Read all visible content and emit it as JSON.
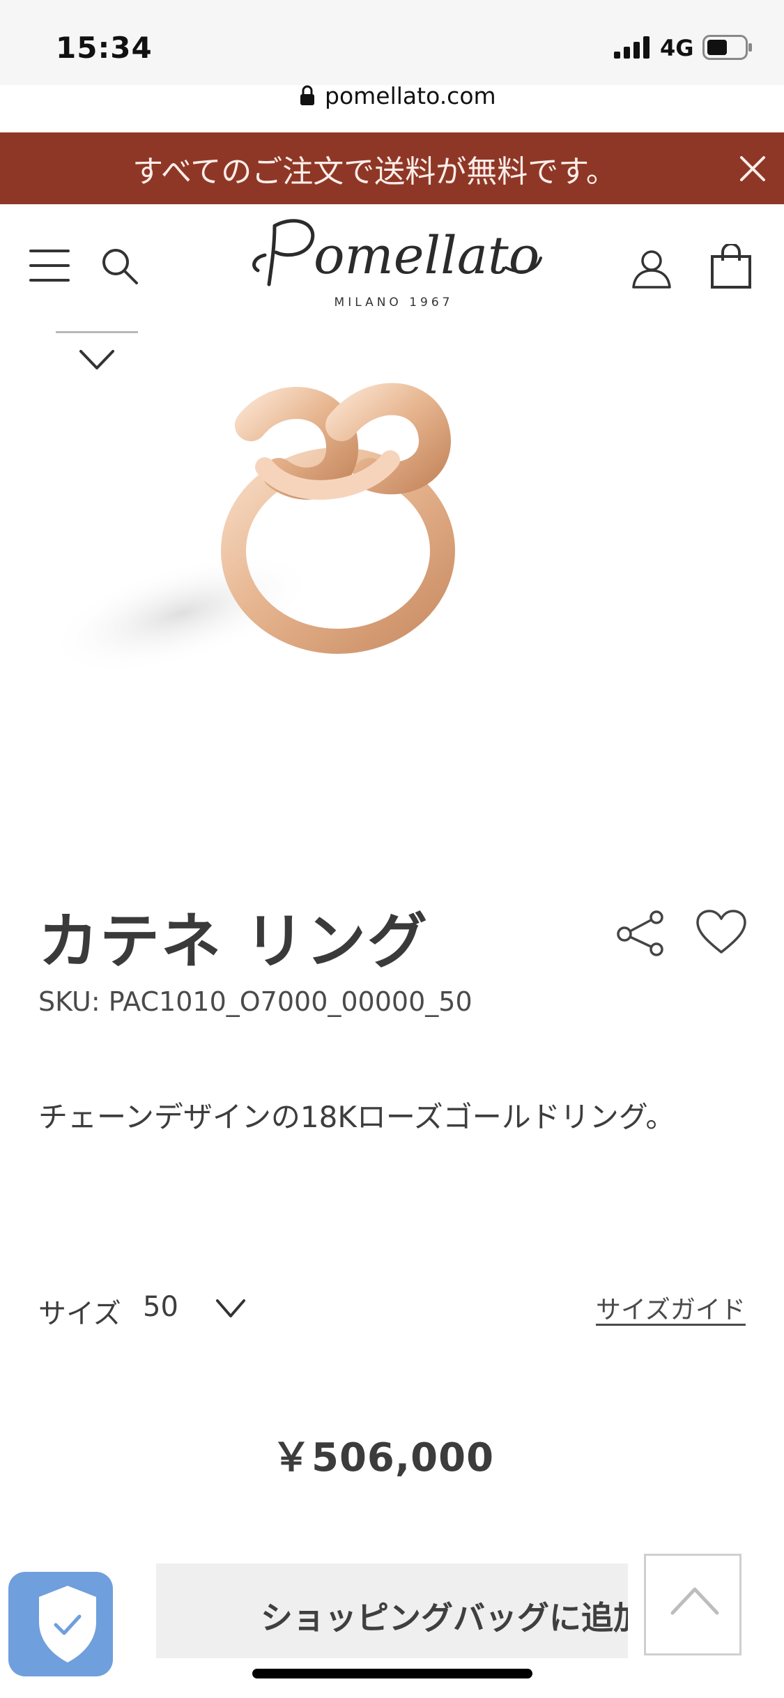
{
  "status_bar": {
    "time": "15:34",
    "network": "4G",
    "url": "pomellato.com"
  },
  "promo": {
    "text": "すべてのご注文で送料が無料です。",
    "background_color": "#8f3726"
  },
  "header": {
    "logo_text": "Pomellato",
    "logo_subtitle": "MILANO 1967"
  },
  "product": {
    "title": "カテネ リング",
    "sku": "SKU: PAC1010_O7000_00000_50",
    "description": "チェーンデザインの18Kローズゴールドリング。",
    "size_label": "サイズ",
    "size_value": "50",
    "size_guide": "サイズガイド",
    "price": "￥506,000",
    "add_to_bag": "ショッピングバッグに追加"
  },
  "icons": {
    "menu": "menu-icon",
    "search": "search-icon",
    "account": "account-icon",
    "bag": "shopping-bag-icon",
    "share": "share-icon",
    "favorite": "heart-icon",
    "close": "close-icon",
    "back_to_top": "chevron-up-icon",
    "trust_badge": "shield-check-icon"
  }
}
